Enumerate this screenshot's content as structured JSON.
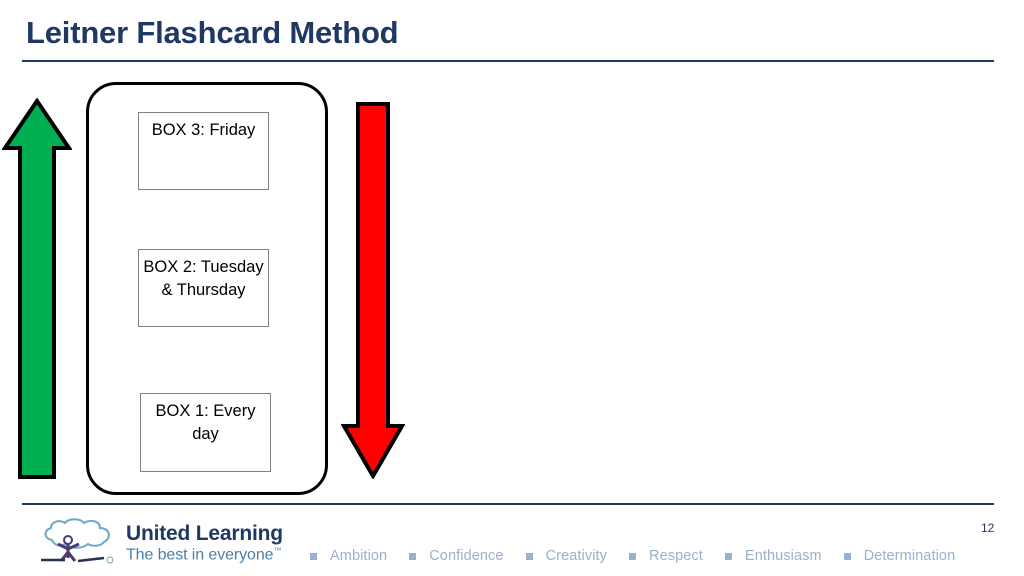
{
  "slide": {
    "title": "Leitner Flashcard Method",
    "page_number": "12",
    "accent_color": "#1F3864",
    "background_color": "#FFFFFF"
  },
  "diagram": {
    "container_label": "leitner-box-stack",
    "boxes": [
      {
        "id": "box3",
        "label": "BOX 3: Friday"
      },
      {
        "id": "box2",
        "label": "BOX 2: Tuesday & Thursday"
      },
      {
        "id": "box1",
        "label": "BOX 1: Every day"
      }
    ],
    "arrows": [
      {
        "id": "green-arrow",
        "direction": "up",
        "color": "#00B050",
        "outline_color": "#000000"
      },
      {
        "id": "red-arrow",
        "direction": "down",
        "color": "#FF0000",
        "outline_color": "#000000"
      }
    ]
  },
  "footer": {
    "logo": {
      "name": "United Learning",
      "tagline": "The best in everyone",
      "trademark": "™",
      "mark_color": "#6FA8C8",
      "figure_color": "#4A3A74"
    },
    "values": [
      {
        "label": "Ambition"
      },
      {
        "label": "Confidence"
      },
      {
        "label": "Creativity"
      },
      {
        "label": "Respect"
      },
      {
        "label": "Enthusiasm"
      },
      {
        "label": "Determination"
      }
    ],
    "values_color": "#9BB0CE"
  }
}
